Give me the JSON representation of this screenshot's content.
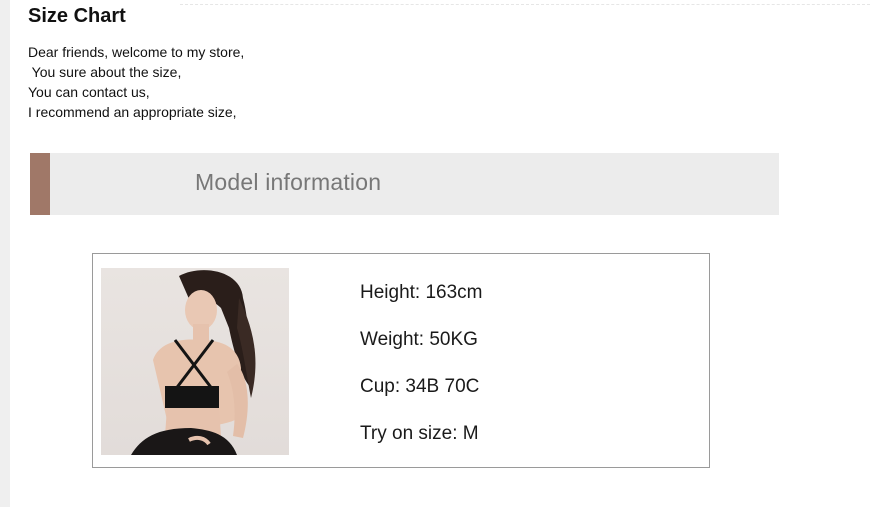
{
  "header": {
    "title": "Size Chart"
  },
  "intro": {
    "lines": [
      "Dear friends, welcome to my store,",
      " You sure about the size,",
      "You can contact us,",
      "I recommend an appropriate size,"
    ]
  },
  "banner": {
    "title": "Model information",
    "accent_color": "#a07868",
    "background_color": "#ececec"
  },
  "model": {
    "photo_icon": "model-photo",
    "details": [
      "Height: 163cm",
      "Weight: 50KG",
      "Cup: 34B 70C",
      "Try on size: M"
    ]
  }
}
